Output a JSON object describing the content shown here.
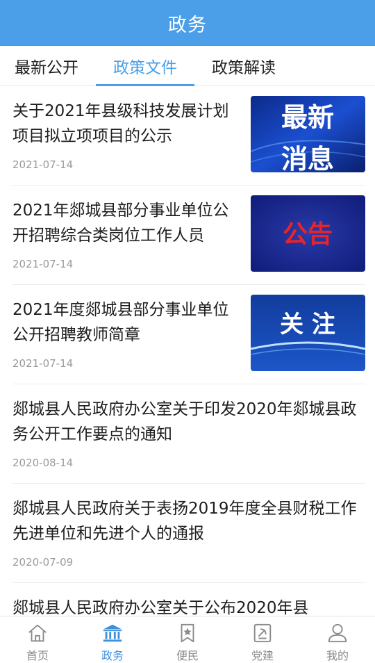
{
  "header": {
    "title": "政务"
  },
  "tabs": [
    {
      "label": "最新公开"
    },
    {
      "label": "政策文件"
    },
    {
      "label": "政策解读"
    }
  ],
  "active_tab": "政策文件",
  "articles": [
    {
      "title": "关于2021年县级科技发展计划项目拟立项项目的公示",
      "date": "2021-07-14",
      "thumbnail_text": "最新消息"
    },
    {
      "title": "2021年郯城县部分事业单位公开招聘综合类岗位工作人员",
      "date": "2021-07-14",
      "thumbnail_text": "公告"
    },
    {
      "title": "2021年度郯城县部分事业单位公开招聘教师简章",
      "date": "2021-07-14",
      "thumbnail_text": "关注"
    },
    {
      "title": "郯城县人民政府办公室关于印发2020年郯城县政务公开工作要点的通知",
      "date": "2020-08-14"
    },
    {
      "title": "郯城县人民政府关于表扬2019年度全县财税工作先进单位和先进个人的通报",
      "date": "2020-07-09"
    },
    {
      "title": "郯城县人民政府办公室关于公布2020年县",
      "date": ""
    }
  ],
  "bottom_nav": [
    {
      "label": "首页",
      "icon": "home-icon"
    },
    {
      "label": "政务",
      "icon": "government-building-icon"
    },
    {
      "label": "便民",
      "icon": "bookmark-star-icon"
    },
    {
      "label": "党建",
      "icon": "party-emblem-icon"
    },
    {
      "label": "我的",
      "icon": "user-icon"
    }
  ],
  "colors": {
    "primary": "#4a9fe8",
    "nav_active": "#3e8fdc",
    "nav_inactive": "#8a8a8a",
    "date": "#9a9a9a"
  }
}
